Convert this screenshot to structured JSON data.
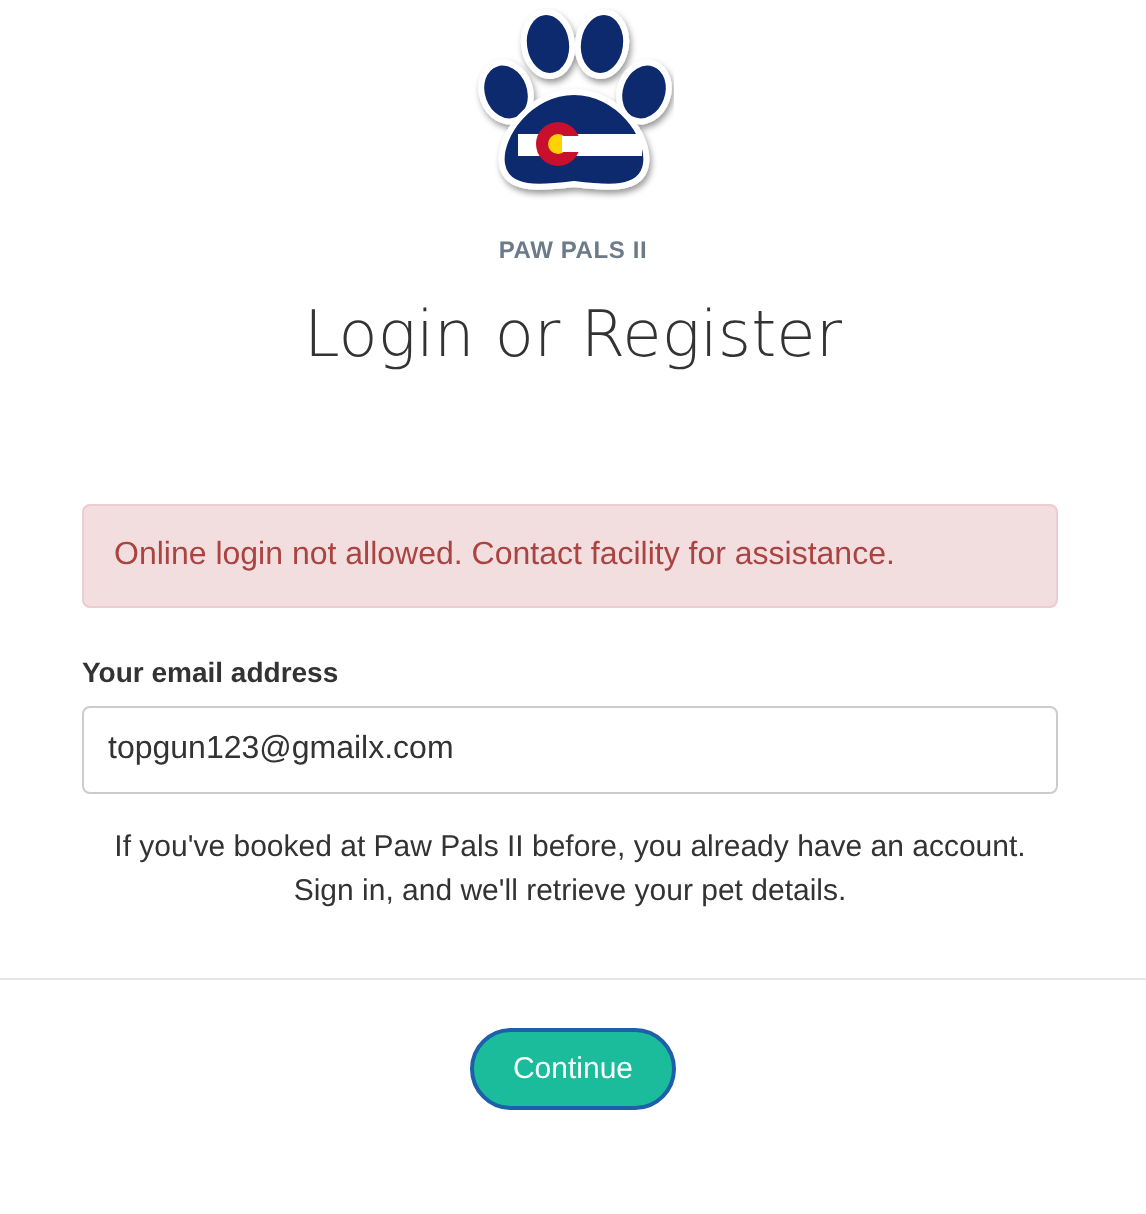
{
  "brand": {
    "name": "PAW PALS II"
  },
  "heading": "Login or Register",
  "alert": {
    "message": "Online login not allowed. Contact facility for assistance."
  },
  "email": {
    "label": "Your email address",
    "value": "topgun123@gmailx.com"
  },
  "help": [
    "If you've booked at Paw Pals II before, you already have an account.",
    "Sign in, and we'll retrieve your pet details."
  ],
  "buttons": [
    "Continue"
  ]
}
